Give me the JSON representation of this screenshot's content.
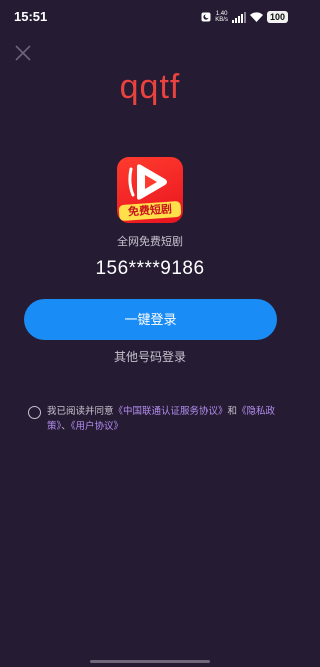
{
  "status_bar": {
    "time": "15:51",
    "net_speed_value": "1.40",
    "net_speed_unit": "KB/s",
    "battery": "100"
  },
  "app": {
    "title": "qqtf",
    "logo_text": "免费短剧",
    "subtitle": "全网免费短剧",
    "masked_phone": "156****9186"
  },
  "actions": {
    "one_click_login": "一键登录",
    "other_login": "其他号码登录"
  },
  "agreement": {
    "prefix": "我已阅读并同意",
    "link1": "《中国联通认证服务协议》",
    "conj": "和",
    "link2": "《隐私政策》",
    "sep": "、",
    "link3": "《用户协议》"
  },
  "colors": {
    "background": "#251b32",
    "title": "#e9423f",
    "primary_button": "#1a8cf5",
    "link": "#b48ef0"
  }
}
